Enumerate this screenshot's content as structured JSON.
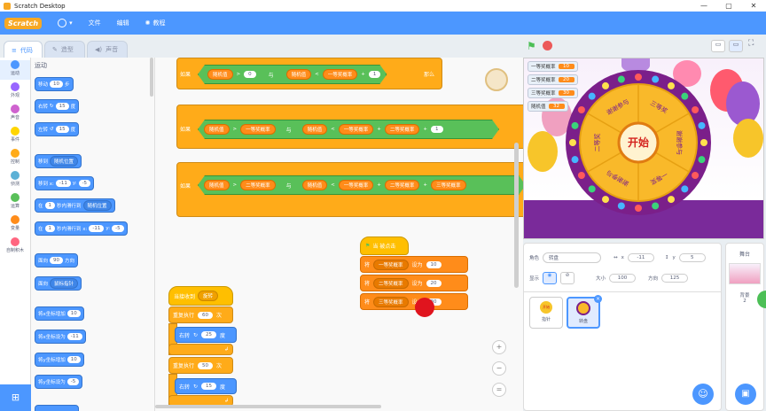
{
  "window": {
    "title": "Scratch Desktop",
    "controls": [
      "—",
      "▢",
      "✕"
    ]
  },
  "menu": {
    "brand": "Scratch",
    "file": "文件",
    "edit": "编辑",
    "tutorials": "教程"
  },
  "tabs": {
    "code": "代码",
    "costumes": "造型",
    "sounds": "声音"
  },
  "categories": [
    {
      "label": "运动",
      "color": "#4c97ff"
    },
    {
      "label": "外观",
      "color": "#9966ff"
    },
    {
      "label": "声音",
      "color": "#cf63cf"
    },
    {
      "label": "事件",
      "color": "#ffd500"
    },
    {
      "label": "控制",
      "color": "#ffab19"
    },
    {
      "label": "侦测",
      "color": "#5cb1d6"
    },
    {
      "label": "运算",
      "color": "#59c059"
    },
    {
      "label": "变量",
      "color": "#ff8c1a"
    },
    {
      "label": "自制积木",
      "color": "#ff6680"
    }
  ],
  "flyout": {
    "title": "运动",
    "b1": {
      "pre": "移动",
      "val": "10",
      "post": "步"
    },
    "b2": {
      "pre": "右转",
      "val": "15",
      "post": "度"
    },
    "b3": {
      "pre": "左转",
      "val": "15",
      "post": "度"
    },
    "b4": {
      "pre": "移到",
      "dd": "随机位置"
    },
    "b5": {
      "pre": "移到 x:",
      "x": "-11",
      "mid": "y:",
      "y": "-5"
    },
    "b6": {
      "pre": "在",
      "val": "1",
      "mid": "秒内滑行到",
      "dd": "随机位置"
    },
    "b7": {
      "pre": "在",
      "val": "1",
      "mid": "秒内滑行到 x:",
      "x": "-11",
      "ymid": "y:",
      "y": "-5"
    },
    "b8": {
      "pre": "面向",
      "val": "90",
      "post": "方向"
    },
    "b9": {
      "pre": "面向",
      "dd": "鼠标指针"
    },
    "b10": {
      "pre": "将x坐标增加",
      "val": "10"
    },
    "b11": {
      "pre": "将x坐标设为",
      "val": "-11"
    },
    "b12": {
      "pre": "将y坐标增加",
      "val": "10"
    },
    "b13": {
      "pre": "将y坐标设为",
      "val": "-5"
    }
  },
  "script_if": {
    "if_label": "如果",
    "then_label": "那么",
    "and_label": "与",
    "row1": {
      "a": "随机值",
      "op1": ">",
      "v1": "0",
      "b": "随机值",
      "op2": "<",
      "c": "一等奖概率",
      "op3": "+",
      "v2": "1"
    },
    "row2": {
      "a": "随机值",
      "op1": ">",
      "b": "一等奖概率",
      "c": "随机值",
      "op2": "<",
      "d": "一等奖概率",
      "op3": "+",
      "e": "二等奖概率",
      "op4": "+",
      "v": "1"
    },
    "row3": {
      "a": "随机值",
      "op1": ">",
      "b": "二等奖概率",
      "c": "随机值",
      "op2": "<",
      "d": "一等奖概率",
      "op3": "+",
      "e": "二等奖概率",
      "op4": "+",
      "f": "三等奖概率"
    }
  },
  "script_flag": {
    "hat": "当 被点击",
    "set": "将",
    "to": "设为",
    "rows": [
      {
        "var": "一等奖概率",
        "val": "10"
      },
      {
        "var": "二等奖概率",
        "val": "20"
      },
      {
        "var": "三等奖概率",
        "val": "30"
      }
    ]
  },
  "script_msg": {
    "hat_pre": "当接收到",
    "hat_dd": "旋转",
    "repeat1": {
      "pre": "重复执行",
      "val": "60",
      "post": "次"
    },
    "turn1": {
      "pre": "右转",
      "val": "25",
      "post": "度"
    },
    "repeat2": {
      "pre": "重复执行",
      "val": "50",
      "post": "次"
    },
    "turn2": {
      "pre": "右转",
      "val": "15",
      "post": "度"
    }
  },
  "zoom": {
    "in": "+",
    "out": "−",
    "reset": "="
  },
  "monitors": [
    {
      "label": "一等奖概率",
      "value": "10"
    },
    {
      "label": "二等奖概率",
      "value": "20"
    },
    {
      "label": "三等奖概率",
      "value": "30"
    },
    {
      "label": "随机值",
      "value": "32"
    }
  ],
  "wheel": {
    "center": "开始",
    "segments": [
      "三等奖",
      "谢谢参与",
      "一等奖",
      "谢谢参与",
      "二等奖",
      "谢谢参与"
    ]
  },
  "sprite_info": {
    "sprite_label": "角色",
    "sprite_name": "转盘",
    "x_label": "x",
    "x": "-11",
    "y_label": "y",
    "y": "5",
    "show_label": "显示",
    "size_label": "大小",
    "size": "100",
    "dir_label": "方向",
    "dir": "125"
  },
  "sprites": [
    {
      "name": "指针",
      "tag": "开始"
    },
    {
      "name": "转盘",
      "tag": ""
    }
  ],
  "stage_pane": {
    "title": "舞台",
    "backdrop_label": "背景",
    "backdrop_count": "2"
  }
}
